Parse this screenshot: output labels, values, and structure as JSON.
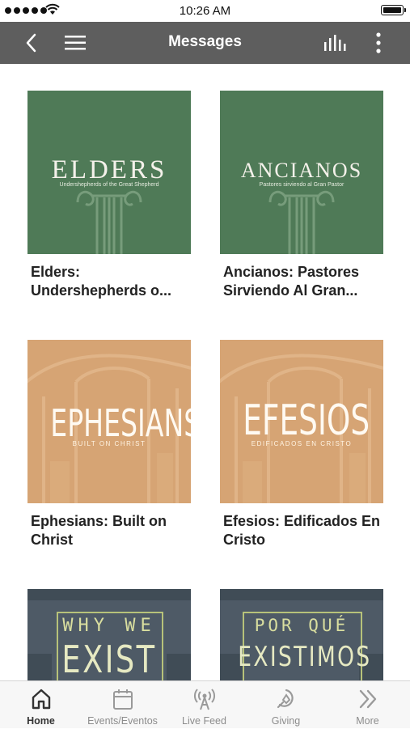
{
  "status_bar": {
    "time": "10:26 AM"
  },
  "header": {
    "title": "Messages"
  },
  "series": [
    {
      "thumb_title": "ELDERS",
      "thumb_subtitle": "Undershepherds of the Great Shepherd",
      "label": "Elders: Undershepherds o...",
      "style": "green"
    },
    {
      "thumb_title": "ANCIANOS",
      "thumb_subtitle": "Pastores sirviendo al Gran Pastor",
      "label": "Ancianos: Pastores Sirviendo Al Gran...",
      "style": "green"
    },
    {
      "thumb_title": "EPHESIANS",
      "thumb_subtitle": "BUILT ON CHRIST",
      "label": "Ephesians: Built on Christ",
      "style": "orange"
    },
    {
      "thumb_title": "EFESIOS",
      "thumb_subtitle": "EDIFICADOS EN CRISTO",
      "label": "Efesios: Edificados En Cristo",
      "style": "orange"
    },
    {
      "thumb_line1": "WHY WE",
      "thumb_line2": "EXIST",
      "style": "slate"
    },
    {
      "thumb_line1": "POR QUÉ",
      "thumb_line2": "EXISTIMOS",
      "style": "slate"
    }
  ],
  "tabs": [
    {
      "label": "Home",
      "icon": "home-icon",
      "active": true
    },
    {
      "label": "Events/Eventos",
      "icon": "calendar-icon",
      "active": false
    },
    {
      "label": "Live Feed",
      "icon": "broadcast-icon",
      "active": false
    },
    {
      "label": "Giving",
      "icon": "giving-icon",
      "active": false
    },
    {
      "label": "More",
      "icon": "double-chevron-right-icon",
      "active": false
    }
  ],
  "colors": {
    "nav_bar": "#5e5e5e",
    "green_tile": "#4f7a57",
    "orange_tile": "#d6a474",
    "slate_tile": "#4e5a66",
    "tab_bar": "#f7f7f7"
  }
}
